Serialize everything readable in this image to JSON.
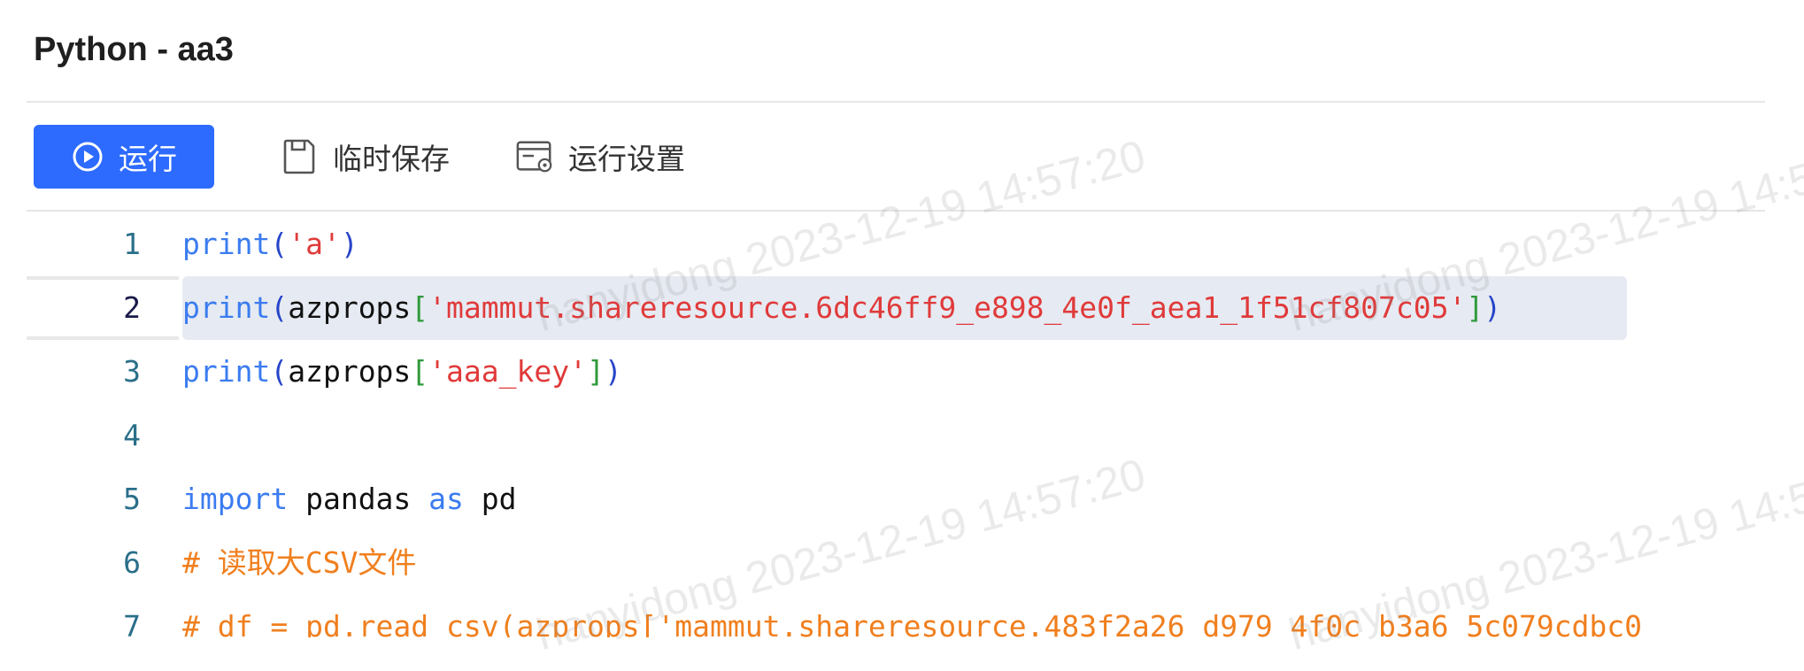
{
  "title": "Python - aa3",
  "toolbar": {
    "run_label": "运行",
    "save_label": "临时保存",
    "settings_label": "运行设置"
  },
  "editor": {
    "active_line": 2,
    "lines": [
      {
        "num": "1",
        "tokens": [
          {
            "t": "print",
            "c": "fn"
          },
          {
            "t": "(",
            "c": "paren"
          },
          {
            "t": "'a'",
            "c": "str"
          },
          {
            "t": ")",
            "c": "paren"
          }
        ]
      },
      {
        "num": "2",
        "tokens": [
          {
            "t": "print",
            "c": "fn"
          },
          {
            "t": "(",
            "c": "paren"
          },
          {
            "t": "azprops",
            "c": "id"
          },
          {
            "t": "[",
            "c": "brk"
          },
          {
            "t": "'mammut.shareresource.6dc46ff9_e898_4e0f_aea1_1f51cf807c05'",
            "c": "str"
          },
          {
            "t": "]",
            "c": "brk"
          },
          {
            "t": ")",
            "c": "paren"
          }
        ]
      },
      {
        "num": "3",
        "tokens": [
          {
            "t": "print",
            "c": "fn"
          },
          {
            "t": "(",
            "c": "paren"
          },
          {
            "t": "azprops",
            "c": "id"
          },
          {
            "t": "[",
            "c": "brk"
          },
          {
            "t": "'aaa_key'",
            "c": "str"
          },
          {
            "t": "]",
            "c": "brk"
          },
          {
            "t": ")",
            "c": "paren"
          }
        ]
      },
      {
        "num": "4",
        "tokens": []
      },
      {
        "num": "5",
        "tokens": [
          {
            "t": "import",
            "c": "kw"
          },
          {
            "t": " pandas ",
            "c": "id"
          },
          {
            "t": "as",
            "c": "kw"
          },
          {
            "t": " pd",
            "c": "id"
          }
        ]
      },
      {
        "num": "6",
        "tokens": [
          {
            "t": "# 读取大CSV文件",
            "c": "cm"
          }
        ]
      },
      {
        "num": "7",
        "tokens": [
          {
            "t": "# df = pd.read_csv(azprops['mammut.shareresource.483f2a26_d979_4f0c_b3a6_5c079cdbc0",
            "c": "cm"
          }
        ]
      }
    ]
  },
  "watermark": {
    "text": "hanyidong 2023-12-19 14:57:20"
  }
}
